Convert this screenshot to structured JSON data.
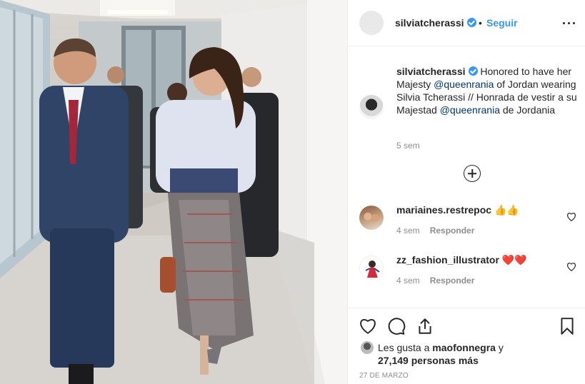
{
  "post": {
    "author": "silviatcherassi",
    "follow_label": "Seguir",
    "dot": "•",
    "photo_alt": "Queen Rania walking in a hallway wearing a Silvia Tcherassi outfit"
  },
  "caption": {
    "username": "silviatcherassi",
    "parts": [
      " Honored to have her Majesty ",
      "@queenrania",
      " of Jordan wearing Silvia Tcherassi // Honrada de vestir a su Majestad ",
      "@queenrania",
      " de Jordania"
    ],
    "time": "5 sem"
  },
  "comments": [
    {
      "username": "mariaines.restrepoc",
      "text": " 👍👍",
      "time": "4 sem",
      "reply_label": "Responder"
    },
    {
      "username": "zz_fashion_illustrator",
      "text": " ❤️❤️",
      "time": "4 sem",
      "reply_label": "Responder"
    }
  ],
  "likes": {
    "prefix": "Les gusta a ",
    "user": "maofonnegra",
    "suffix": " y",
    "count_text": "27,149 personas más"
  },
  "date": "27 DE MARZO",
  "icons": {
    "more": "more-horizontal-icon",
    "like": "heart-icon",
    "comment": "comment-bubble-icon",
    "share": "share-icon",
    "save": "bookmark-icon",
    "load_more": "plus-circle-icon",
    "verified": "verified-badge-icon"
  },
  "colors": {
    "link_blue": "#3897f0",
    "mention": "#00376b",
    "meta_gray": "#8e8e8e",
    "text": "#262626",
    "heart_red": "#ed4956"
  }
}
